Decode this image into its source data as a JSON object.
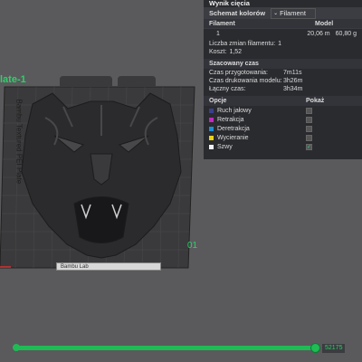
{
  "viewport": {
    "plate_label": "late-1",
    "plate_vertical_text": "Bambu Textured PEI Plate",
    "plate_number": "01",
    "brand_strip_text": "Bambu Lab"
  },
  "panel": {
    "title": "Wynik cięcia",
    "scheme_label": "Schemat kolorów",
    "scheme_value": "Filament",
    "table_headers": {
      "filament": "Filament",
      "model": "Model"
    },
    "filament_row": {
      "index": "1",
      "length": "20,06 m",
      "weight": "60,80 g"
    },
    "summary": [
      {
        "k": "Liczba zmian filamentu:",
        "v": "1"
      },
      {
        "k": "Koszt:",
        "v": "1,52"
      }
    ],
    "time_section": "Szacowany czas",
    "times": [
      {
        "k": "Czas przygotowania:",
        "v": "7m11s"
      },
      {
        "k": "Czas drukowania modelu:",
        "v": "3h26m"
      },
      {
        "k": "Łączny czas:",
        "v": "3h34m"
      }
    ],
    "options_header": {
      "opcje": "Opcje",
      "pokaz": "Pokaż"
    },
    "options": [
      {
        "label": "Ruch jałowy",
        "color": "#3b3f8f",
        "checked": false
      },
      {
        "label": "Retrakcja",
        "color": "#c02ac0",
        "checked": false
      },
      {
        "label": "Deretrakcja",
        "color": "#1a8fd6",
        "checked": false
      },
      {
        "label": "Wycieranie",
        "color": "#e8d21a",
        "checked": false
      },
      {
        "label": "Szwy",
        "color": "#f2f2f2",
        "checked": true
      }
    ]
  },
  "bottom": {
    "zoom_text": "52175",
    "progress_fraction": 1.0
  }
}
